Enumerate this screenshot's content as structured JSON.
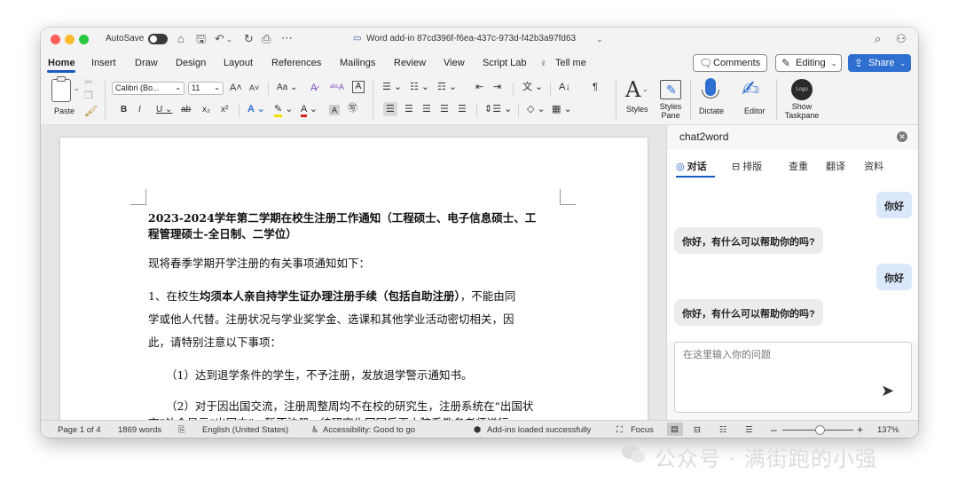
{
  "titlebar": {
    "autosave_label": "AutoSave",
    "title": "Word add-in 87cd396f-f6ea-437c-973d-f42b3a97fd63",
    "icons": [
      "home-icon",
      "save-icon",
      "undo-icon",
      "redo-icon",
      "print-icon",
      "more-icon",
      "search-icon",
      "share-person-icon"
    ]
  },
  "tabs": [
    "Home",
    "Insert",
    "Draw",
    "Design",
    "Layout",
    "References",
    "Mailings",
    "Review",
    "View",
    "Script Lab"
  ],
  "tell_me": "Tell me",
  "actions": {
    "comments": "Comments",
    "editing": "Editing",
    "share": "Share"
  },
  "ribbon": {
    "paste": "Paste",
    "font_name": "Calibri (Bo...",
    "font_size": "11",
    "styles": "Styles",
    "styles_pane": "Styles Pane",
    "dictate": "Dictate",
    "editor": "Editor",
    "show_taskpane": "Show Taskpane",
    "logo_text": "Logo"
  },
  "document": {
    "title_line1": "2023-2024学年第二学期在校生注册工作通知（工程硕士、电子信息硕士、工",
    "title_line2": "程管理硕士-全日制、二学位）",
    "intro": "现将春季学期开学注册的有关事项通知如下：",
    "p1_a": "1、在校生",
    "p1_b": "均须本人亲自持学生证办理注册手续（包括自助注册）",
    "p1_c": "，不能由同",
    "p1_line2": "学或他人代替。注册状况与学业奖学金、选课和其他学业活动密切相关，因",
    "p1_line3": "此，请特别注意以下事项：",
    "item1": "（1）达到退学条件的学生，不予注册，发放退学警示通知书。",
    "item2": "（2）对于因出国交流，注册周整周均不在校的研究生，注册系统在“出国状",
    "item2_cont": "态”处会显示“出国中”，暂不注册，待研究生回国后再由院系教务老师进行"
  },
  "panel": {
    "title": "chat2word",
    "tabs": [
      "对话",
      "排版",
      "查重",
      "翻译",
      "资料"
    ],
    "messages": [
      {
        "role": "user",
        "text": "你好"
      },
      {
        "role": "assistant",
        "text": "你好，有什么可以帮助你的吗?"
      },
      {
        "role": "user",
        "text": "你好"
      },
      {
        "role": "assistant",
        "text": "你好，有什么可以帮助你的吗?"
      }
    ],
    "input_placeholder": "在这里输入你的问题"
  },
  "status": {
    "page": "Page 1 of 4",
    "words": "1869 words",
    "language": "English (United States)",
    "accessibility": "Accessibility: Good to go",
    "addins": "Add-ins loaded successfully",
    "focus": "Focus",
    "zoom": "137%"
  },
  "watermark": "公众号 · 满街跑的小强",
  "colors": {
    "accent": "#185abd",
    "share_bg": "#2f6fd0",
    "user_bubble": "#dbe8fb",
    "ai_bubble": "#ececec"
  }
}
